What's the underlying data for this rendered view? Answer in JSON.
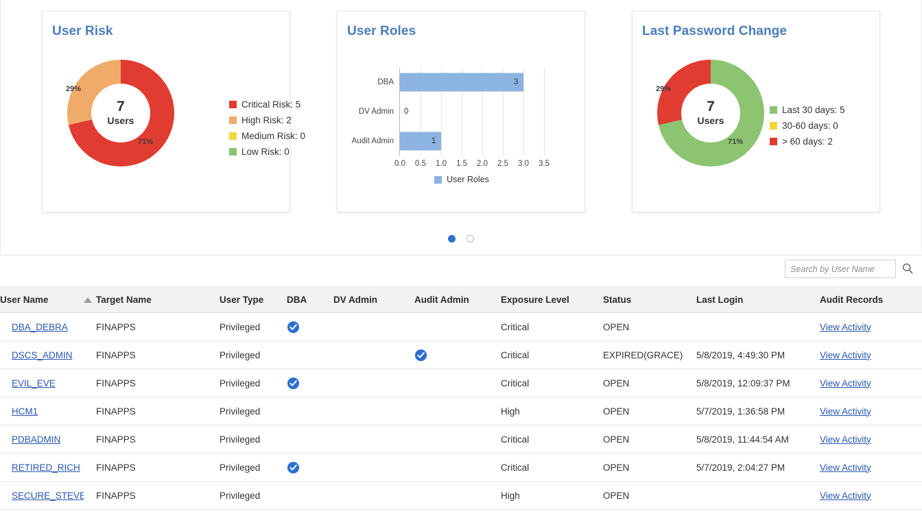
{
  "colors": {
    "critical_red": "#e03c31",
    "high_orange": "#f0ab6a",
    "medium_yellow": "#f2d63c",
    "low_green": "#8cc472",
    "bar_blue": "#8cb4e2",
    "title_blue": "#4a7ebb",
    "link_blue": "#2756b3",
    "check_blue": "#2c6fd1"
  },
  "cards": {
    "user_risk": {
      "title": "User Risk",
      "center_count": "7",
      "center_unit": "Users",
      "pct_primary": "71%",
      "pct_secondary": "29%",
      "legend": [
        {
          "label": "Critical Risk: 5",
          "color": "#e03c31"
        },
        {
          "label": "High Risk: 2",
          "color": "#f0ab6a"
        },
        {
          "label": "Medium Risk: 0",
          "color": "#f2d63c"
        },
        {
          "label": "Low Risk: 0",
          "color": "#8cc472"
        }
      ]
    },
    "user_roles": {
      "title": "User Roles",
      "legend_label": "User Roles"
    },
    "last_password_change": {
      "title": "Last Password Change",
      "center_count": "7",
      "center_unit": "Users",
      "pct_primary": "71%",
      "pct_secondary": "29%",
      "legend": [
        {
          "label": "Last 30 days: 5",
          "color": "#8cc472"
        },
        {
          "label": "30-60 days: 0",
          "color": "#f2d63c"
        },
        {
          "label": "> 60 days: 2",
          "color": "#e03c31"
        }
      ]
    }
  },
  "chart_data": [
    {
      "type": "pie",
      "title": "User Risk",
      "labels": [
        "Critical Risk",
        "High Risk",
        "Medium Risk",
        "Low Risk"
      ],
      "values": [
        5,
        2,
        0,
        0
      ],
      "percents": [
        71,
        29,
        0,
        0
      ],
      "colors": [
        "#e03c31",
        "#f0ab6a",
        "#f2d63c",
        "#8cc472"
      ],
      "center_label": "7 Users",
      "legend_position": "right",
      "donut": true
    },
    {
      "type": "bar",
      "title": "User Roles",
      "orientation": "horizontal",
      "categories": [
        "DBA",
        "DV Admin",
        "Audit Admin"
      ],
      "values": [
        3,
        0,
        1
      ],
      "series": [
        {
          "name": "User Roles",
          "values": [
            3,
            0,
            1
          ]
        }
      ],
      "xlabel": "",
      "ylabel": "",
      "xlim": [
        0,
        3.5
      ],
      "xticks": [
        "0.0",
        "0.5",
        "1.0",
        "1.5",
        "2.0",
        "2.5",
        "3.0",
        "3.5"
      ],
      "xtick_values": [
        0,
        0.5,
        1.0,
        1.5,
        2.0,
        2.5,
        3.0,
        3.5
      ],
      "grid": true,
      "legend_position": "bottom",
      "color": "#8cb4e2"
    },
    {
      "type": "pie",
      "title": "Last Password Change",
      "labels": [
        "Last 30 days",
        "30-60 days",
        "> 60 days"
      ],
      "values": [
        5,
        0,
        2
      ],
      "percents": [
        71,
        0,
        29
      ],
      "colors": [
        "#8cc472",
        "#f2d63c",
        "#e03c31"
      ],
      "center_label": "7 Users",
      "legend_position": "right",
      "donut": true
    }
  ],
  "carousel": {
    "dots": 2,
    "active_index": 0
  },
  "search": {
    "placeholder": "Search by User Name",
    "value": "",
    "icon": "search-icon"
  },
  "table": {
    "columns": [
      "User Name",
      "Target Name",
      "User Type",
      "DBA",
      "DV Admin",
      "Audit Admin",
      "Exposure Level",
      "Status",
      "Last Login",
      "Audit Records"
    ],
    "sort_column": "User Name",
    "sort_direction": "asc",
    "rows": [
      {
        "user_name": "DBA_DEBRA",
        "target_name": "FINAPPS",
        "user_type": "Privileged",
        "dba": true,
        "dv_admin": false,
        "audit_admin": false,
        "exposure_level": "Critical",
        "status": "OPEN",
        "last_login": "",
        "audit_records": "View Activity"
      },
      {
        "user_name": "DSCS_ADMIN",
        "target_name": "FINAPPS",
        "user_type": "Privileged",
        "dba": false,
        "dv_admin": false,
        "audit_admin": true,
        "exposure_level": "Critical",
        "status": "EXPIRED(GRACE)",
        "last_login": "5/8/2019, 4:49:30 PM",
        "audit_records": "View Activity"
      },
      {
        "user_name": "EVIL_EVE",
        "target_name": "FINAPPS",
        "user_type": "Privileged",
        "dba": true,
        "dv_admin": false,
        "audit_admin": false,
        "exposure_level": "Critical",
        "status": "OPEN",
        "last_login": "5/8/2019, 12:09:37 PM",
        "audit_records": "View Activity"
      },
      {
        "user_name": "HCM1",
        "target_name": "FINAPPS",
        "user_type": "Privileged",
        "dba": false,
        "dv_admin": false,
        "audit_admin": false,
        "exposure_level": "High",
        "status": "OPEN",
        "last_login": "5/7/2019, 1:36:58 PM",
        "audit_records": "View Activity"
      },
      {
        "user_name": "PDBADMIN",
        "target_name": "FINAPPS",
        "user_type": "Privileged",
        "dba": false,
        "dv_admin": false,
        "audit_admin": false,
        "exposure_level": "Critical",
        "status": "OPEN",
        "last_login": "5/8/2019, 11:44:54 AM",
        "audit_records": "View Activity"
      },
      {
        "user_name": "RETIRED_RICH",
        "target_name": "FINAPPS",
        "user_type": "Privileged",
        "dba": true,
        "dv_admin": false,
        "audit_admin": false,
        "exposure_level": "Critical",
        "status": "OPEN",
        "last_login": "5/7/2019, 2:04:27 PM",
        "audit_records": "View Activity"
      },
      {
        "user_name": "SECURE_STEVE",
        "target_name": "FINAPPS",
        "user_type": "Privileged",
        "dba": false,
        "dv_admin": false,
        "audit_admin": false,
        "exposure_level": "High",
        "status": "OPEN",
        "last_login": "",
        "audit_records": "View Activity"
      }
    ]
  }
}
